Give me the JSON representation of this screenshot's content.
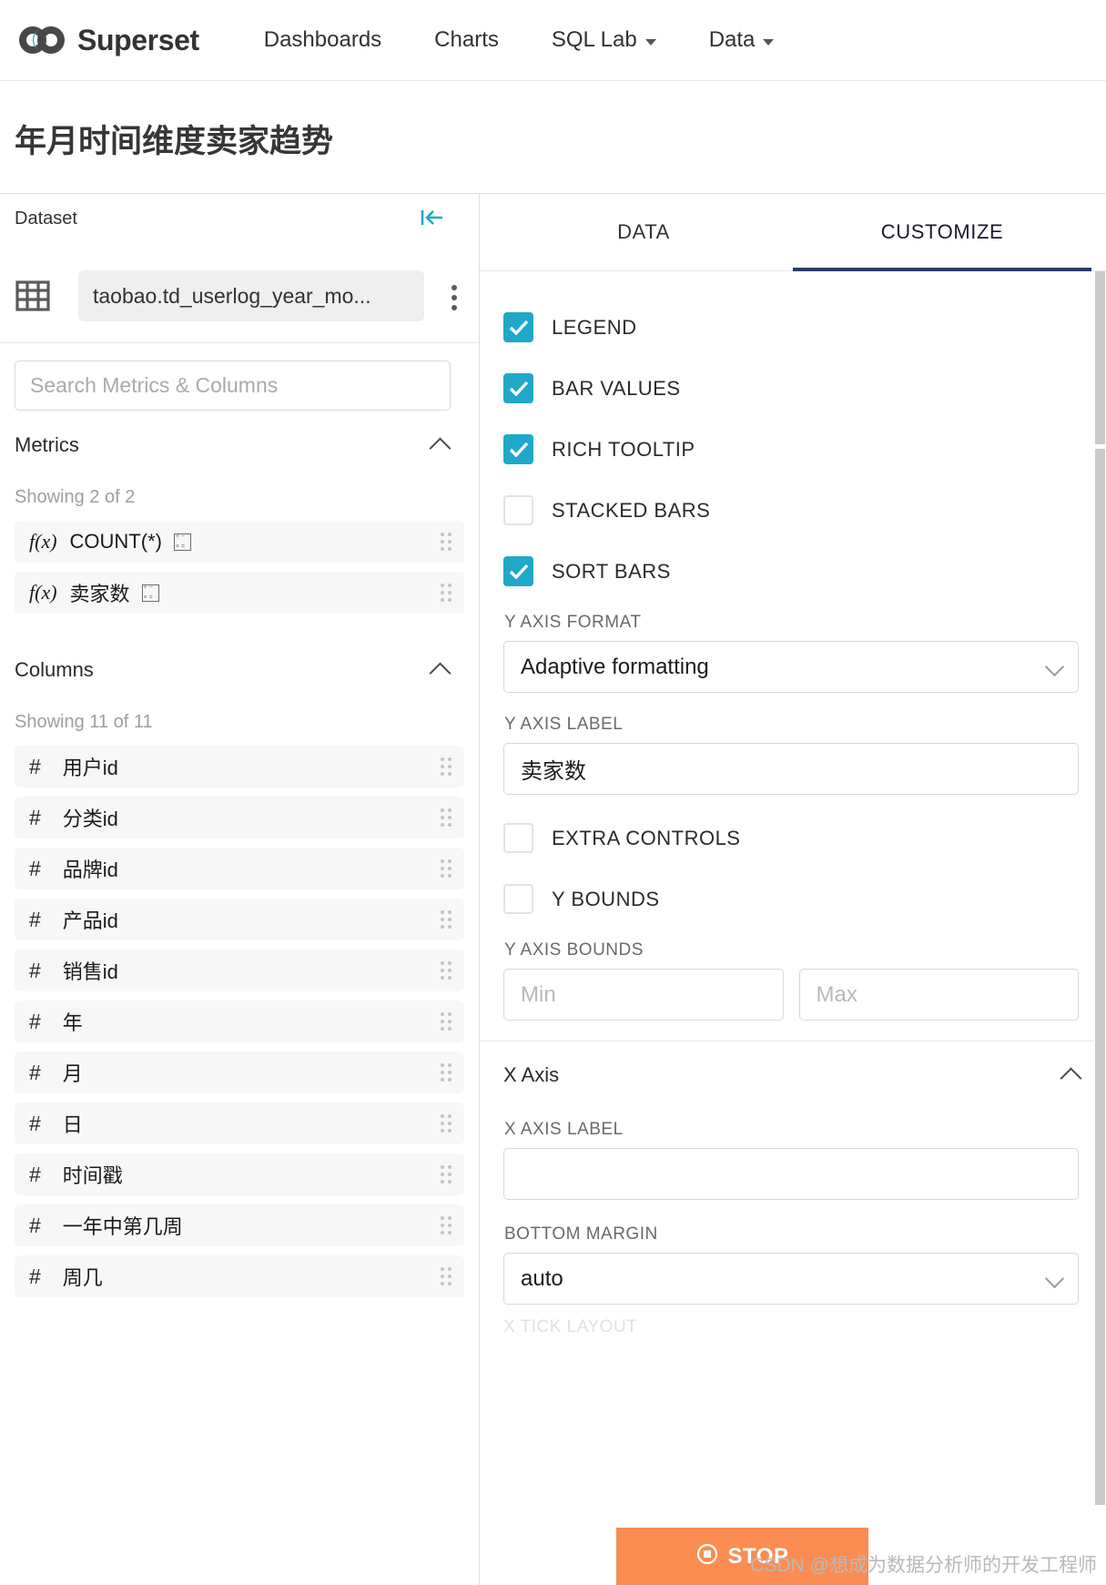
{
  "header": {
    "brand": "Superset",
    "logo_icon": "superset-infinity-logo",
    "nav": [
      {
        "label": "Dashboards",
        "has_caret": false
      },
      {
        "label": "Charts",
        "has_caret": false
      },
      {
        "label": "SQL Lab",
        "has_caret": true
      },
      {
        "label": "Data",
        "has_caret": true
      }
    ]
  },
  "page": {
    "title": "年月时间维度卖家趋势"
  },
  "dataset_panel": {
    "label": "Dataset",
    "collapse_icon": "collapse-left-icon",
    "table_icon": "table-grid-icon",
    "dataset_name": "taobao.td_userlog_year_mo...",
    "kebab_icon": "more-vertical-icon",
    "search": {
      "placeholder": "Search Metrics & Columns",
      "value": ""
    },
    "metrics": {
      "title": "Metrics",
      "showing": "Showing 2 of 2",
      "items": [
        {
          "prefix": "f(x)",
          "label": "COUNT(*)",
          "type_icon": "calculator-icon"
        },
        {
          "prefix": "f(x)",
          "label": "卖家数",
          "type_icon": "calculator-icon"
        }
      ]
    },
    "columns": {
      "title": "Columns",
      "showing": "Showing 11 of 11",
      "items": [
        {
          "prefix": "#",
          "label": "用户id"
        },
        {
          "prefix": "#",
          "label": "分类id"
        },
        {
          "prefix": "#",
          "label": "品牌id"
        },
        {
          "prefix": "#",
          "label": "产品id"
        },
        {
          "prefix": "#",
          "label": "销售id"
        },
        {
          "prefix": "#",
          "label": "年"
        },
        {
          "prefix": "#",
          "label": "月"
        },
        {
          "prefix": "#",
          "label": "日"
        },
        {
          "prefix": "#",
          "label": "时间戳"
        },
        {
          "prefix": "#",
          "label": "一年中第几周"
        },
        {
          "prefix": "#",
          "label": "周几"
        }
      ]
    }
  },
  "control_panel": {
    "tabs": [
      {
        "label": "DATA",
        "active": false
      },
      {
        "label": "CUSTOMIZE",
        "active": true
      }
    ],
    "active_tab_accent": "#2c3a64",
    "checkbox_accent": "#1fa8c9",
    "checkboxes": [
      {
        "label": "LEGEND",
        "checked": true
      },
      {
        "label": "BAR VALUES",
        "checked": true
      },
      {
        "label": "RICH TOOLTIP",
        "checked": true
      },
      {
        "label": "STACKED BARS",
        "checked": false
      },
      {
        "label": "SORT BARS",
        "checked": true
      }
    ],
    "y_axis_format": {
      "label": "Y AXIS FORMAT",
      "value": "Adaptive formatting"
    },
    "y_axis_label": {
      "label": "Y AXIS LABEL",
      "value": "卖家数"
    },
    "extra_controls": {
      "label": "EXTRA CONTROLS",
      "checked": false
    },
    "y_bounds_toggle": {
      "label": "Y BOUNDS",
      "checked": false
    },
    "y_axis_bounds": {
      "label": "Y AXIS BOUNDS",
      "min_placeholder": "Min",
      "max_placeholder": "Max",
      "min_value": "",
      "max_value": ""
    },
    "x_axis_section": {
      "title": "X Axis",
      "x_axis_label": {
        "label": "X AXIS LABEL",
        "value": ""
      },
      "bottom_margin": {
        "label": "BOTTOM MARGIN",
        "value": "auto"
      },
      "next_label_partial": "X TICK LAYOUT"
    },
    "stop_button": {
      "label": "STOP",
      "icon": "stop-circle-icon",
      "color": "#fb8c52"
    }
  },
  "watermark": {
    "text": "CSDN @想成为数据分析师的开发工程师"
  }
}
